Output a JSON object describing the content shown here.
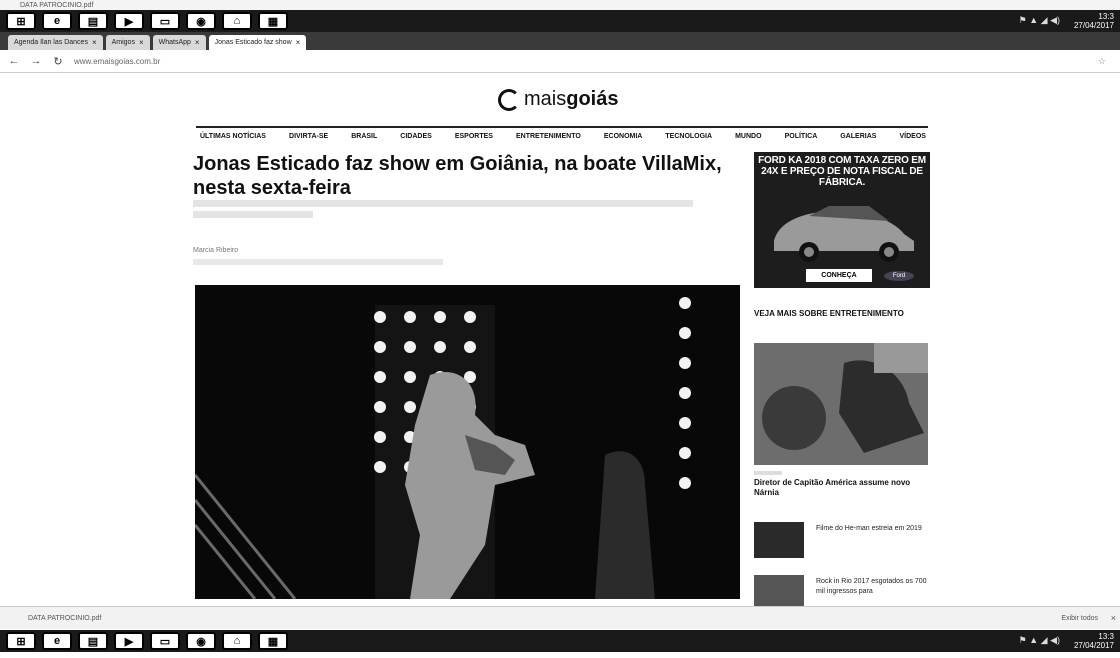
{
  "os": {
    "top_strip": [
      "DATA PATROCINIO.pdf"
    ],
    "clock_time": "13:3",
    "clock_date": "27/04/2017"
  },
  "browser": {
    "tabs": [
      {
        "label": "Agenda Ilan las Dances"
      },
      {
        "label": "Amigos"
      },
      {
        "label": "WhatsApp"
      },
      {
        "label": "Jonas Esticado faz show"
      }
    ],
    "url": "www.emaisgoias.com.br"
  },
  "site": {
    "logo_light": "mais",
    "logo_bold": "goiás",
    "nav": [
      "ÚLTIMAS NOTÍCIAS",
      "DIVIRTA-SE",
      "BRASIL",
      "CIDADES",
      "ESPORTES",
      "ENTRETENIMENTO",
      "ECONOMIA",
      "TECNOLOGIA",
      "MUNDO",
      "POLÍTICA",
      "GALERIAS",
      "VÍDEOS"
    ],
    "article": {
      "headline": "Jonas Esticado faz show em Goiânia, na boate VillaMix, nesta sexta-feira",
      "author": "Marcia Ribeiro"
    },
    "ad": {
      "text": "FORD KA 2018 COM TAXA ZERO EM 24X E PREÇO DE NOTA FISCAL DE FÁBRICA.",
      "button": "CONHEÇA",
      "brand": "Ford"
    },
    "sidebar": {
      "section_title": "VEJA MAIS SOBRE ENTRETENIMENTO",
      "featured_title": "Diretor de Capitão América assume novo Nárnia",
      "items": [
        {
          "title": "Filme do He-man estreia em 2019"
        },
        {
          "title": "Rock in Rio 2017 esgotados os 700 mil ingressos para"
        }
      ]
    }
  },
  "downloads": {
    "items": [
      "DATA PATROCINIO.pdf"
    ],
    "show_all": "Exibir todos"
  }
}
